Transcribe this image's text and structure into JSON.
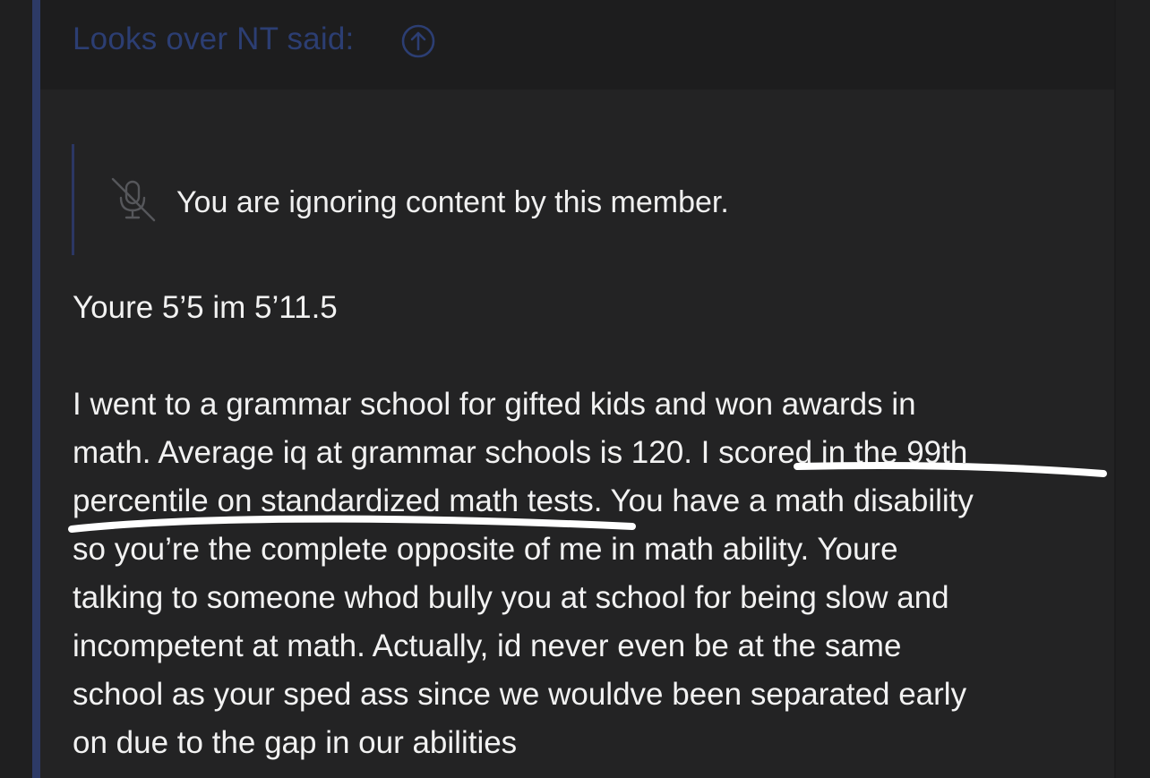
{
  "quote": {
    "author_label": "Looks over NT said:",
    "author_color": "#2c3e73",
    "jump_icon": "up-arrow-circle-icon"
  },
  "ignored": {
    "icon": "muted-microphone-icon",
    "text": "You are ignoring content by this member."
  },
  "post": {
    "line1": "Youre 5’5 im 5’11.5",
    "paragraph": [
      "I went to a grammar school for gifted kids and won awards in",
      "math. Average iq at grammar schools is 120. I scored in the 99th",
      "percentile on standardized math tests. You have a math disability",
      "so you’re the complete opposite of me in math ability. Youre",
      "talking to someone whod bully you at school for being slow and",
      "incompetent at math. Actually, id never even be at the same",
      "school as your sped ass since we wouldve been separated early",
      "on due to the gap in our abilities"
    ]
  },
  "colors": {
    "background": "#1f1f20",
    "quote_background": "#232324",
    "quote_border": "#2d3a66",
    "text": "#f2f2f2",
    "annotation": "#ffffff"
  }
}
